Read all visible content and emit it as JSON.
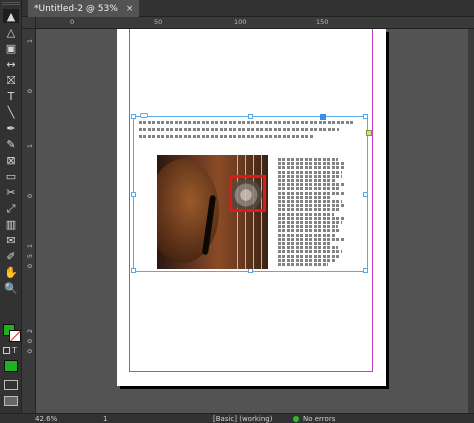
{
  "window": {
    "tab_title": "*Untitled-2 @ 53%",
    "close_glyph": "×"
  },
  "rulers": {
    "top_labels": [
      "0",
      "50",
      "100",
      "150"
    ],
    "left_labels": [
      "1",
      "0",
      "1",
      "0",
      "1",
      "5",
      "0",
      "2",
      "0",
      "0"
    ]
  },
  "tools": [
    {
      "name": "selection-tool-icon",
      "glyph": "▲"
    },
    {
      "name": "direct-selection-tool-icon",
      "glyph": "△"
    },
    {
      "name": "page-tool-icon",
      "glyph": "▣"
    },
    {
      "name": "gap-tool-icon",
      "glyph": "↔"
    },
    {
      "name": "content-collector-icon",
      "glyph": "⛝"
    },
    {
      "name": "type-tool-icon",
      "glyph": "T"
    },
    {
      "name": "line-tool-icon",
      "glyph": "╲"
    },
    {
      "name": "pen-tool-icon",
      "glyph": "✒"
    },
    {
      "name": "pencil-tool-icon",
      "glyph": "✎"
    },
    {
      "name": "rectangle-frame-tool-icon",
      "glyph": "⊠"
    },
    {
      "name": "rectangle-tool-icon",
      "glyph": "▭"
    },
    {
      "name": "scissors-tool-icon",
      "glyph": "✂"
    },
    {
      "name": "free-transform-tool-icon",
      "glyph": "⤢"
    },
    {
      "name": "gradient-swatch-tool-icon",
      "glyph": "▥"
    },
    {
      "name": "note-tool-icon",
      "glyph": "✉"
    },
    {
      "name": "eyedropper-tool-icon",
      "glyph": "✐"
    },
    {
      "name": "hand-tool-icon",
      "glyph": "✋"
    },
    {
      "name": "zoom-tool-icon",
      "glyph": "🔍"
    }
  ],
  "colors": {
    "fill_swatch": "#21b021",
    "stroke_swatch": "#ffffff",
    "status_ok": "#26c026",
    "selection": "#5aa9e6",
    "margin_guide": "#c040c0",
    "highlight_box": "#e01818"
  },
  "status": {
    "zoom": "42.6%",
    "page": "1",
    "style": "[Basic] (working)",
    "errors": "No errors"
  }
}
